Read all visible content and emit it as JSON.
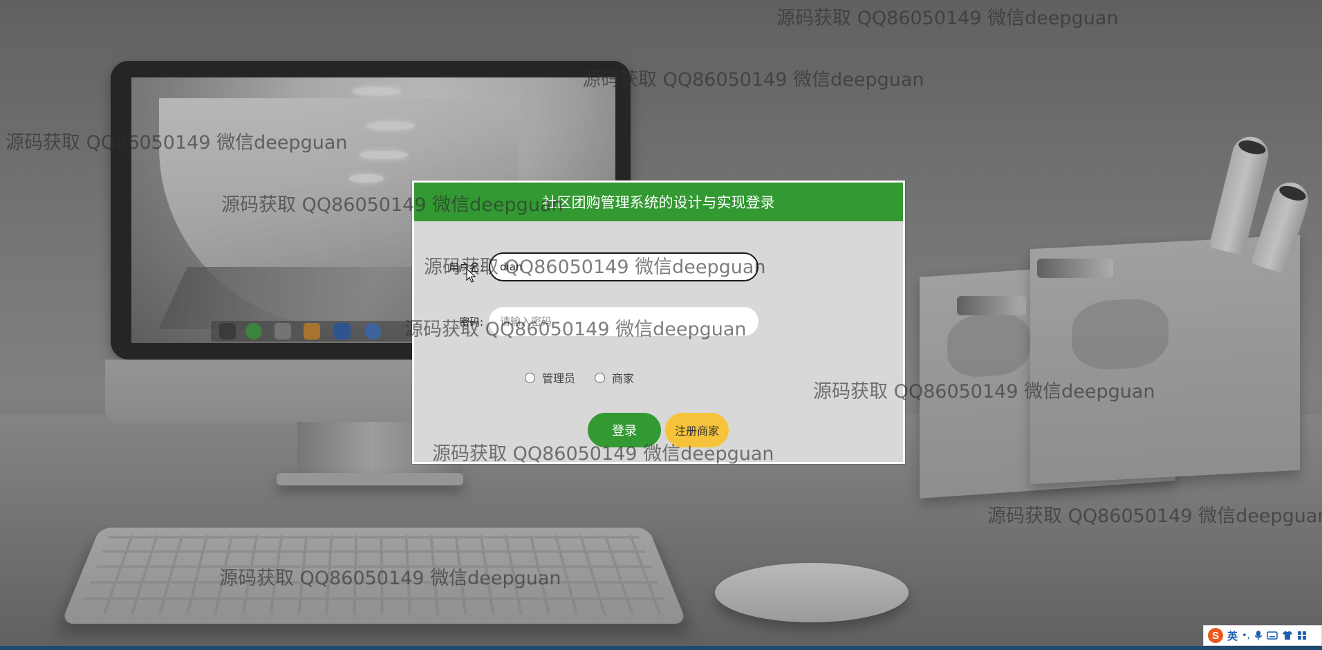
{
  "login": {
    "title": "社区团购管理系统的设计与实现登录",
    "username_label": "用户名:",
    "username_value": "dian",
    "password_label": "密码:",
    "password_placeholder": "请输入密码",
    "roles": [
      "管理员",
      "商家"
    ],
    "login_button": "登录",
    "register_button": "注册商家"
  },
  "watermark_text": "源码获取 QQ86050149 微信deepguan",
  "ime": {
    "logo": "S",
    "mode": "英"
  },
  "colors": {
    "header_green": "#339933",
    "register_yellow": "#f6c33a",
    "dialog_bg": "#d8d8d8"
  },
  "icons": [
    "cursor-icon",
    "radio-icon",
    "ime-sogou-icon",
    "microphone-icon",
    "keyboard-icon",
    "shirt-icon",
    "grid-icon"
  ]
}
